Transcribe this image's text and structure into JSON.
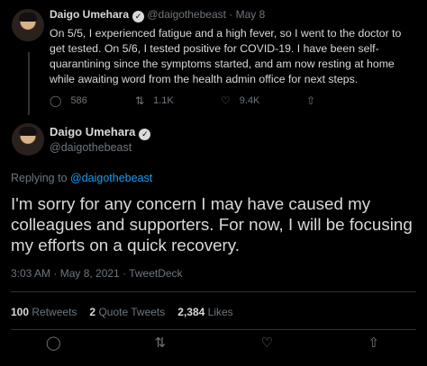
{
  "tweet1": {
    "name": "Daigo Umehara",
    "handle": "@daigothebeast",
    "sep": " · ",
    "date": "May 8",
    "text": "On 5/5, I experienced fatigue and a high fever, so I went to the doctor to get tested. On 5/6, I tested positive for COVID-19. I have been self-quarantining since the symptoms started, and am now resting at home while awaiting word from the health admin office for next steps.",
    "replies": "586",
    "retweets": "1.1K",
    "likes": "9.4K"
  },
  "tweet2": {
    "name": "Daigo Umehara",
    "handle": "@daigothebeast",
    "replying_label": "Replying to ",
    "replying_handle": "@daigothebeast",
    "text": "I'm sorry for any concern I may have caused my colleagues and supporters. For now, I will be focusing my efforts on a quick recovery.",
    "meta": "3:03 AM · May 8, 2021 · TweetDeck",
    "retweets_count": "100",
    "retweets_label": "Retweets",
    "quotes_count": "2",
    "quotes_label": "Quote Tweets",
    "likes_count": "2,384",
    "likes_label": "Likes"
  },
  "icons": {
    "reply": "reply-icon",
    "retweet": "retweet-icon",
    "like": "heart-icon",
    "share": "share-icon",
    "verified": "verified-badge-icon"
  },
  "colors": {
    "background": "#000000",
    "text": "#d9d9d9",
    "muted": "#6e767d",
    "link": "#1d9bf0"
  }
}
